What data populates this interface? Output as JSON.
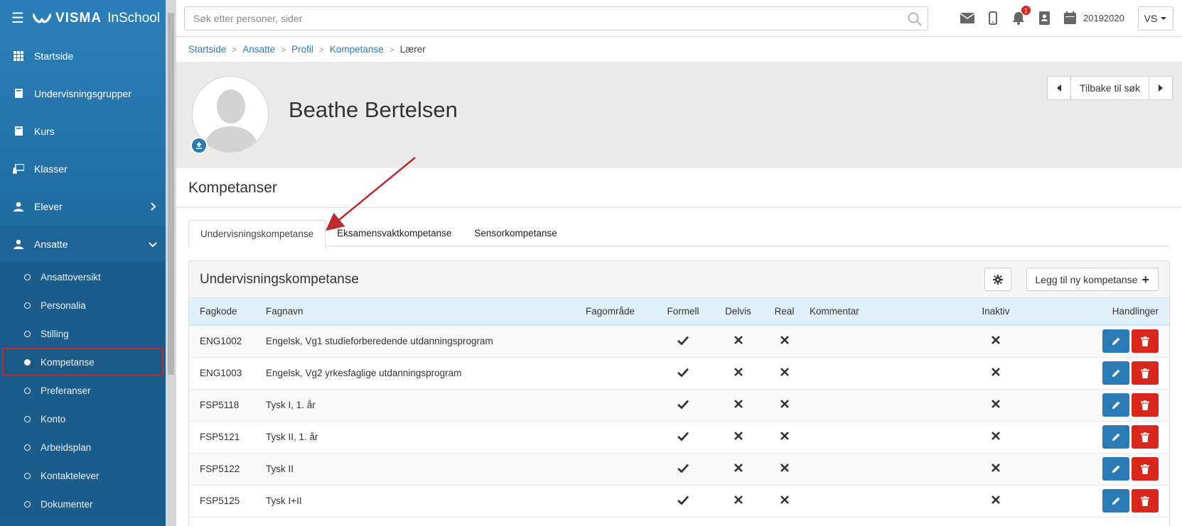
{
  "brand": {
    "name": "VISMA",
    "product": "InSchool"
  },
  "sidebar": {
    "items": [
      {
        "label": "Startside",
        "icon": "grid-icon"
      },
      {
        "label": "Undervisningsgrupper",
        "icon": "book-icon"
      },
      {
        "label": "Kurs",
        "icon": "book-icon"
      },
      {
        "label": "Klasser",
        "icon": "teacher-board-icon"
      },
      {
        "label": "Elever",
        "icon": "user-icon",
        "expandable": true
      },
      {
        "label": "Ansatte",
        "icon": "user-icon",
        "expanded": true
      }
    ],
    "sub_items": [
      {
        "label": "Ansattoversikt"
      },
      {
        "label": "Personalia"
      },
      {
        "label": "Stilling"
      },
      {
        "label": "Kompetanse",
        "active": true
      },
      {
        "label": "Preferanser"
      },
      {
        "label": "Konto"
      },
      {
        "label": "Arbeidsplan"
      },
      {
        "label": "Kontaktelever"
      },
      {
        "label": "Dokumenter"
      }
    ]
  },
  "topbar": {
    "search_placeholder": "Søk etter personer, sider",
    "notification_count": "1",
    "school_year": "20192020",
    "user_initials": "VS"
  },
  "breadcrumb": {
    "items": [
      "Startside",
      "Ansatte",
      "Profil",
      "Kompetanse"
    ],
    "current": "Lærer"
  },
  "profile": {
    "name": "Beathe Bertelsen",
    "back_label": "Tilbake til søk"
  },
  "section": {
    "title": "Kompetanser",
    "tabs": [
      "Undervisningskompetanse",
      "Eksamensvaktkompetanse",
      "Sensorkompetanse"
    ],
    "active_tab": 0
  },
  "panel": {
    "title": "Undervisningskompetanse",
    "add_label": "Legg til ny kompetanse",
    "columns": [
      "Fagkode",
      "Fagnavn",
      "Fagområde",
      "Formell",
      "Delvis",
      "Real",
      "Kommentar",
      "Inaktiv",
      "Handlinger"
    ],
    "rows": [
      {
        "code": "ENG1002",
        "name": "Engelsk, Vg1 studieforberedende utdanningsprogram",
        "area": "",
        "formell": true,
        "delvis": false,
        "real": false,
        "comment": "",
        "inaktiv": false
      },
      {
        "code": "ENG1003",
        "name": "Engelsk, Vg2 yrkesfaglige utdanningsprogram",
        "area": "",
        "formell": true,
        "delvis": false,
        "real": false,
        "comment": "",
        "inaktiv": false
      },
      {
        "code": "FSP5118",
        "name": "Tysk I, 1. år",
        "area": "",
        "formell": true,
        "delvis": false,
        "real": false,
        "comment": "",
        "inaktiv": false
      },
      {
        "code": "FSP5121",
        "name": "Tysk II, 1. år",
        "area": "",
        "formell": true,
        "delvis": false,
        "real": false,
        "comment": "",
        "inaktiv": false
      },
      {
        "code": "FSP5122",
        "name": "Tysk II",
        "area": "",
        "formell": true,
        "delvis": false,
        "real": false,
        "comment": "",
        "inaktiv": false
      },
      {
        "code": "FSP5125",
        "name": "Tysk I+II",
        "area": "",
        "formell": true,
        "delvis": false,
        "real": false,
        "comment": "",
        "inaktiv": false
      }
    ]
  },
  "colors": {
    "sidebar": "#206b9f",
    "primary": "#2a7ab5",
    "danger": "#d9261c",
    "highlight": "#c0282f",
    "table_header": "#dff2fb"
  }
}
